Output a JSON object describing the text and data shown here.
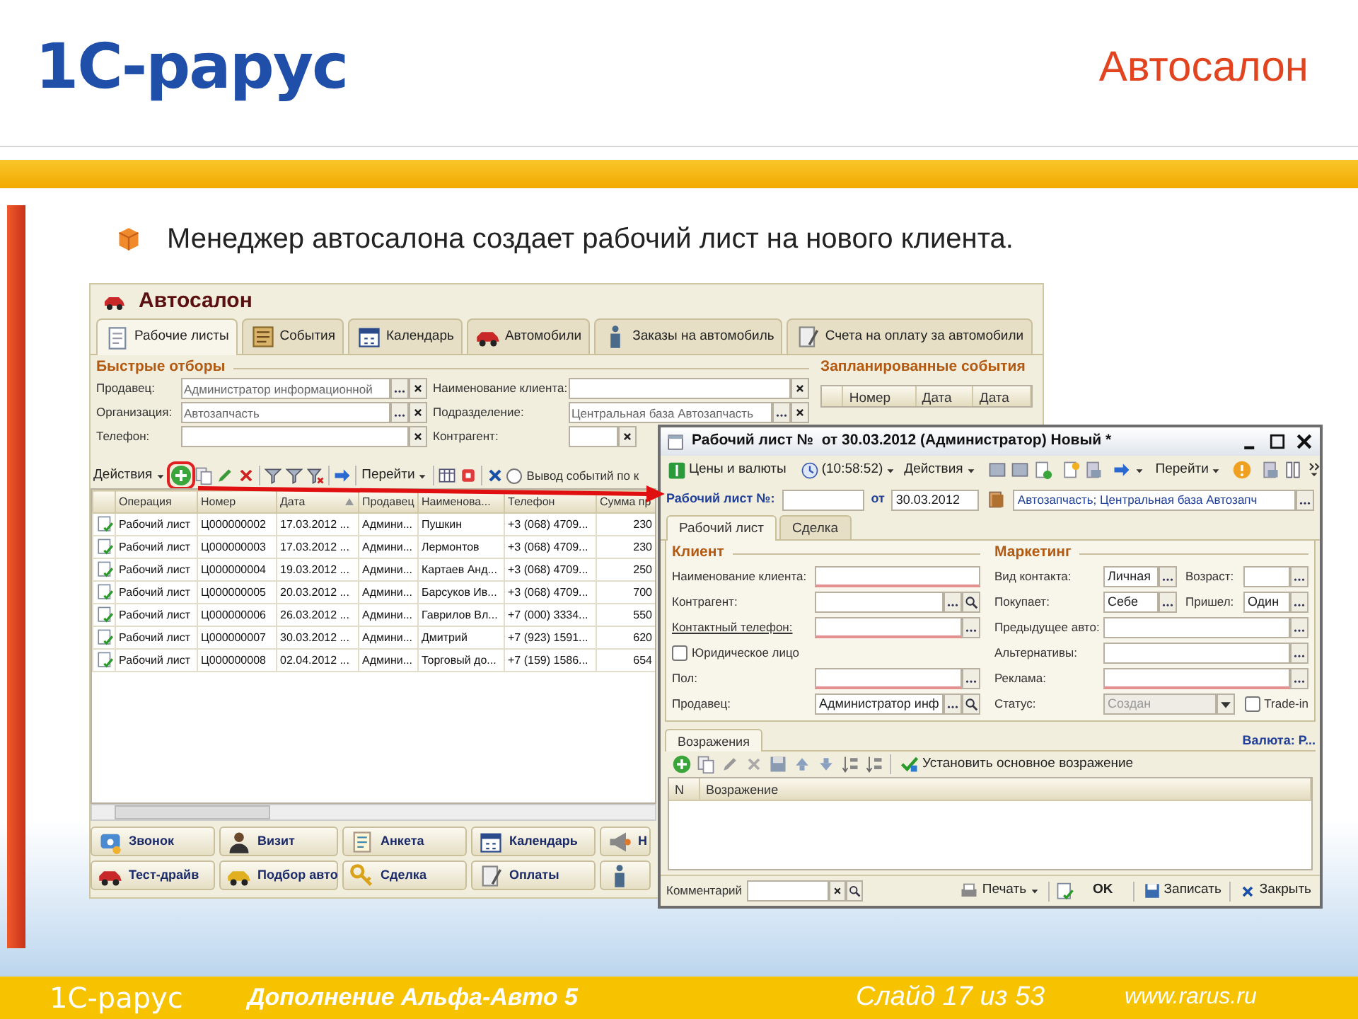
{
  "slide": {
    "logo": "1С-рарус",
    "title": "Автосалон",
    "bullet": "Менеджер автосалона создает рабочий лист на нового клиента."
  },
  "main_window": {
    "title": "Автосалон",
    "tabs": [
      {
        "label": "Рабочие листы",
        "selected": true
      },
      {
        "label": "События",
        "selected": false
      },
      {
        "label": "Календарь",
        "selected": false
      },
      {
        "label": "Автомобили",
        "selected": false
      },
      {
        "label": "Заказы на автомобиль",
        "selected": false
      },
      {
        "label": "Счета на оплату за автомобили",
        "selected": false
      }
    ],
    "quick_filters": {
      "title": "Быстрые отборы",
      "fields": [
        {
          "label": "Продавец:",
          "value": "Администратор информационной",
          "choice": true
        },
        {
          "label": "Наименование клиента:",
          "choice": false
        },
        {
          "label": "Организация:",
          "value": "Автозапчасть",
          "choice": true
        },
        {
          "label": "Подразделение:",
          "value": "Центральная база Автозапчасть",
          "choice": true
        },
        {
          "label": "Телефон:",
          "choice": false
        },
        {
          "label": "Контрагент:",
          "choice": false
        }
      ]
    },
    "scheduled_events": {
      "title": "Запланированные события",
      "columns": [
        "Номер",
        "Дата",
        "Дата"
      ]
    },
    "toolbar": {
      "actions": "Действия",
      "add_highlighted": true,
      "goto": "Перейти",
      "option": {
        "label": "Вывод событий по к",
        "checked": false
      }
    },
    "table": {
      "columns": [
        {
          "label": "Операция",
          "sorted": false
        },
        {
          "label": "Номер",
          "sorted": false
        },
        {
          "label": "Дата",
          "sorted": true
        },
        {
          "label": "Продавец",
          "sorted": false
        },
        {
          "label": "Наименова...",
          "sorted": false
        },
        {
          "label": "Телефон",
          "sorted": false
        },
        {
          "label": "Сумма пр",
          "sorted": false
        }
      ],
      "rows": [
        [
          "Рабочий лист",
          "Ц000000002",
          "17.03.2012 ...",
          "Админи...",
          "Пушкин",
          "+3 (068) 4709...",
          "230"
        ],
        [
          "Рабочий лист",
          "Ц000000003",
          "17.03.2012 ...",
          "Админи...",
          "Лермонтов",
          "+3 (068) 4709...",
          "230"
        ],
        [
          "Рабочий лист",
          "Ц000000004",
          "19.03.2012 ...",
          "Админи...",
          "Картаев Анд...",
          "+3 (068) 4709...",
          "250"
        ],
        [
          "Рабочий лист",
          "Ц000000005",
          "20.03.2012 ...",
          "Админи...",
          "Барсуков Ив...",
          "+3 (068) 4709...",
          "700"
        ],
        [
          "Рабочий лист",
          "Ц000000006",
          "26.03.2012 ...",
          "Админи...",
          "Гаврилов Вл...",
          "+7 (000) 3334...",
          "550"
        ],
        [
          "Рабочий лист",
          "Ц000000007",
          "30.03.2012 ...",
          "Админи...",
          "Дмитрий",
          "+7 (923) 1591...",
          "620"
        ],
        [
          "Рабочий лист",
          "Ц000000008",
          "02.04.2012 ...",
          "Админи...",
          "Торговый до...",
          "+7 (159) 1586...",
          "654"
        ]
      ]
    },
    "buttons": [
      [
        {
          "kind": "text",
          "label": "Звонок"
        },
        {
          "kind": "text",
          "label": "Визит"
        },
        {
          "kind": "text",
          "label": "Анкета"
        },
        {
          "kind": "text",
          "label": "Календарь"
        },
        {
          "kind": "text",
          "label": "Н"
        }
      ],
      [
        {
          "kind": "text",
          "label": "Тест-драйв"
        },
        {
          "kind": "text",
          "label": "Подбор авто"
        },
        {
          "kind": "text",
          "label": "Сделка"
        },
        {
          "kind": "text",
          "label": "Оплаты"
        },
        {
          "kind": "icon"
        }
      ]
    ]
  },
  "document_window": {
    "title": "Рабочий лист №  от 30.03.2012 (Администратор) Новый *",
    "toolbar": {
      "prices": "Цены и валюты",
      "time": "(10:58:52)",
      "actions": "Действия",
      "goto": "Перейти"
    },
    "header": {
      "number_label": "Рабочий лист №:",
      "date_label": "от",
      "date": "30.03.2012",
      "organization": "Автозапчасть; Центральная база Автозапч"
    },
    "tabs": [
      {
        "label": "Рабочий лист",
        "selected": true
      },
      {
        "label": "Сделка",
        "selected": false
      }
    ],
    "client": {
      "title": "Клиент",
      "fields": [
        {
          "kind": "field",
          "label": "Наименование клиента:",
          "required": true,
          "choice": false,
          "search": false,
          "link": false
        },
        {
          "kind": "field",
          "label": "Контрагент:",
          "required": false,
          "choice": true,
          "search": true,
          "link": false
        },
        {
          "kind": "field",
          "label": "Контактный телефон:",
          "required": true,
          "choice": true,
          "search": false,
          "link": true
        },
        {
          "kind": "checkbox",
          "label": "Юридическое лицо",
          "checked": false
        },
        {
          "kind": "field",
          "label": "Пол:",
          "required": true,
          "choice": true,
          "search": false,
          "link": false
        },
        {
          "kind": "field",
          "label": "Продавец:",
          "value": "Администратор инф",
          "required": false,
          "choice": true,
          "search": true,
          "link": false
        }
      ]
    },
    "marketing": {
      "title": "Маркетинг",
      "fields": [
        {
          "kind": "pair",
          "items": [
            {
              "label": "Вид контакта:",
              "value": "Личная"
            },
            {
              "label": "Возраст:"
            }
          ]
        },
        {
          "kind": "pair",
          "items": [
            {
              "label": "Покупает:",
              "value": "Себе"
            },
            {
              "label": "Пришел:",
              "value": "Один"
            }
          ]
        },
        {
          "kind": "field",
          "label": "Предыдущее авто:",
          "required": false
        },
        {
          "kind": "field",
          "label": "Альтернативы:",
          "required": false
        },
        {
          "kind": "field",
          "label": "Реклама:",
          "required": true
        },
        {
          "kind": "status",
          "label": "Статус:",
          "value": "Создан",
          "disabled": true,
          "option": {
            "label": "Trade-in",
            "checked": false
          }
        }
      ]
    },
    "objections": {
      "tab": "Возражения",
      "currency": "Валюта: Р...",
      "action": "Установить основное возражение",
      "columns": [
        "N",
        "Возражение"
      ]
    },
    "footer": {
      "comment_label": "Комментарий",
      "print": "Печать",
      "ok": "OK",
      "save": "Записать",
      "close": "Закрыть"
    }
  },
  "footer": {
    "logo": "1С-рарус",
    "product": "Дополнение Альфа-Авто 5",
    "slide": "Слайд 17 из 53",
    "site": "www.rarus.ru"
  }
}
